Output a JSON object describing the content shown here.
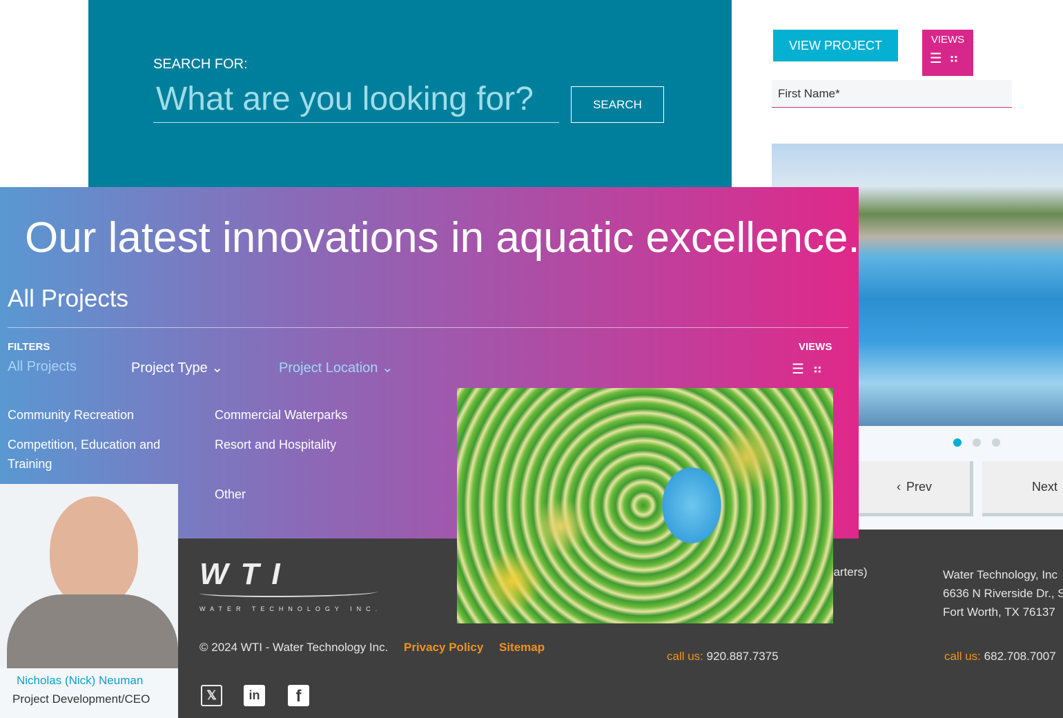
{
  "search": {
    "label": "SEARCH FOR:",
    "placeholder": "What are you looking for?",
    "button": "SEARCH"
  },
  "top_right": {
    "view_project": "VIEW PROJECT",
    "views_label": "VIEWS",
    "first_name_placeholder": "First Name*"
  },
  "carousel": {
    "slide_count": 3,
    "active_slide": 1,
    "prev": "Prev",
    "next": "Next"
  },
  "hero": {
    "headline": "Our latest innovations in aquatic excellence.",
    "section_title": "All Projects",
    "filters_label": "FILTERS",
    "filters": [
      "All Projects",
      "Project Type",
      "Project Location"
    ],
    "views_label": "VIEWS",
    "categories": [
      "Community Recreation",
      "Commercial Waterparks",
      "Competition, Education and Training",
      "Resort and Hospitality",
      "Other"
    ]
  },
  "person": {
    "name": "Nicholas (Nick) Neuman",
    "title": "Project Development/CEO"
  },
  "footer": {
    "logo_text": "WTI",
    "logo_tagline": "WATER TECHNOLOGY INC.",
    "copyright": "© 2024 WTI - Water Technology Inc.",
    "privacy": "Privacy Policy",
    "sitemap": "Sitemap",
    "hq_fragment": "uarters)",
    "call_label": "call us:",
    "phone1": "920.887.7375",
    "address": [
      "Water Technology, Inc",
      "6636 N Riverside Dr., S",
      "Fort Worth, TX 76137"
    ],
    "phone2": "682.708.7007",
    "social": [
      "x-icon",
      "linkedin-icon",
      "facebook-icon"
    ]
  },
  "colors": {
    "teal": "#007f9c",
    "cyan": "#06b0d2",
    "pink": "#d8278b",
    "orange": "#f0931e",
    "footer": "#3f3f3f"
  }
}
